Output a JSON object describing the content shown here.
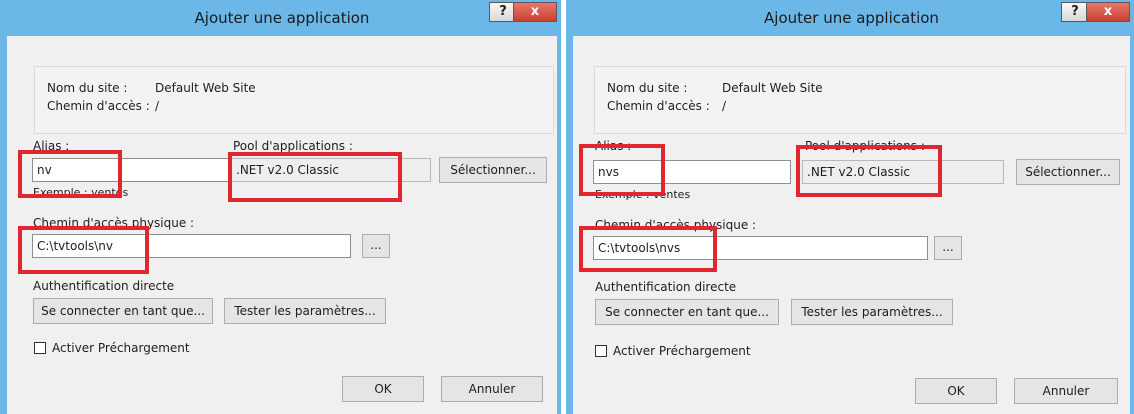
{
  "dialogs": [
    {
      "title": "Ajouter une application",
      "help_label": "?",
      "close_label": "x",
      "site_name_label": "Nom du site :",
      "site_name_value": "Default Web Site",
      "path_label": "Chemin d'accès :",
      "path_value": "/",
      "alias_label": "Alias :",
      "alias_value": "nv",
      "example_text": "Exemple : ventes",
      "pool_label": "Pool d'applications :",
      "pool_value": ".NET v2.0 Classic",
      "select_button": "Sélectionner...",
      "physical_path_label": "Chemin d'accès physique :",
      "physical_path_value": "C:\\tvtools\\nv",
      "browse_button": "...",
      "pass_through_label": "Authentification directe",
      "connect_as_button": "Se connecter en tant que...",
      "test_settings_button": "Tester les paramètres...",
      "preload_label": "Activer Préchargement",
      "preload_checked": false,
      "ok_button": "OK",
      "cancel_button": "Annuler"
    },
    {
      "title": "Ajouter une application",
      "help_label": "?",
      "close_label": "x",
      "site_name_label": "Nom du site :",
      "site_name_value": "Default Web Site",
      "path_label": "Chemin d'accès :",
      "path_value": "/",
      "alias_label": "Alias :",
      "alias_value": "nvs",
      "example_text": "Exemple : ventes",
      "pool_label": "Pool d'applications :",
      "pool_value": ".NET v2.0 Classic",
      "select_button": "Sélectionner...",
      "physical_path_label": "Chemin d'accès physique :",
      "physical_path_value": "C:\\tvtools\\nvs",
      "browse_button": "...",
      "pass_through_label": "Authentification directe",
      "connect_as_button": "Se connecter en tant que...",
      "test_settings_button": "Tester les paramètres...",
      "preload_label": "Activer Préchargement",
      "preload_checked": false,
      "ok_button": "OK",
      "cancel_button": "Annuler"
    }
  ],
  "colors": {
    "titlebar": "#6bb7e8",
    "highlight": "#e0262f",
    "close_button": "#c6412f"
  }
}
